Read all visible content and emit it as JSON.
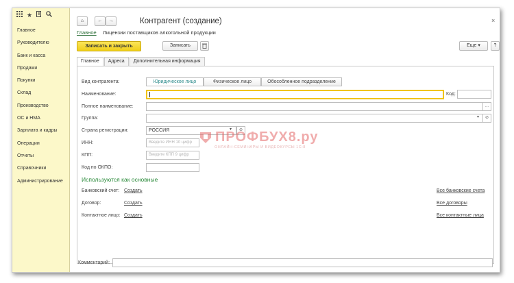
{
  "sidebar": {
    "icons": [
      "grid-icon",
      "star-icon",
      "history-icon",
      "search-icon"
    ],
    "items": [
      {
        "label": "Главное"
      },
      {
        "label": "Руководителю"
      },
      {
        "label": "Банк и касса"
      },
      {
        "label": "Продажи"
      },
      {
        "label": "Покупки"
      },
      {
        "label": "Склад"
      },
      {
        "label": "Производство"
      },
      {
        "label": "ОС и НМА"
      },
      {
        "label": "Зарплата и кадры"
      },
      {
        "label": "Операции"
      },
      {
        "label": "Отчеты"
      },
      {
        "label": "Справочники"
      },
      {
        "label": "Администрирование"
      }
    ]
  },
  "header": {
    "title": "Контрагент (создание)",
    "home_icon": "⌂",
    "back": "←",
    "forward": "→",
    "close": "×"
  },
  "subnav": {
    "main_link": "Главное",
    "license_link": "Лицензии поставщиков алкогольной продукции"
  },
  "toolbar": {
    "save_close": "Записать и закрыть",
    "save": "Записать",
    "more": "Еще",
    "more_arrow": "▾",
    "help": "?"
  },
  "tabs": [
    {
      "label": "Главное"
    },
    {
      "label": "Адреса"
    },
    {
      "label": "Дополнительная информация"
    }
  ],
  "form": {
    "type_label": "Вид контрагента:",
    "type_options": [
      "Юридическое лицо",
      "Физическое лицо",
      "Обособленное подразделение"
    ],
    "name_label": "Наименование:",
    "code_label": "Код:",
    "fullname_label": "Полное наименование:",
    "ellipsis": "...",
    "group_label": "Группа:",
    "dropdown": "▾",
    "link_symbol": "⊘",
    "country_label": "Страна регистрации:",
    "country_value": "РОССИЯ",
    "inn_label": "ИНН:",
    "inn_placeholder": "Введите ИНН 10 цифр",
    "kpp_label": "КПП:",
    "kpp_placeholder": "Введите КПП 9 цифр",
    "okpo_label": "Код по ОКПО:",
    "section_title": "Используются как основные",
    "rows": [
      {
        "label": "Банковский счет:",
        "create": "Создать",
        "all": "Все банковские счета"
      },
      {
        "label": "Договор:",
        "create": "Создать",
        "all": "Все договоры"
      },
      {
        "label": "Контактное лицо:",
        "create": "Создать",
        "all": "Все контактные лица"
      }
    ]
  },
  "footer": {
    "comment_label": "Комментарий:"
  },
  "watermark": {
    "brand": "ПРОФБУХ8.ру",
    "tagline": "ОНЛАЙН-СЕМИНАРЫ И ВИДЕОКУРСЫ 1С:8"
  },
  "colors": {
    "sidebar_bg": "#fcf8c9",
    "primary_button": "#f5d630",
    "accent_green": "#2a8a3a",
    "link_blue": "#2a3a8f",
    "focus_border": "#f0c419"
  }
}
